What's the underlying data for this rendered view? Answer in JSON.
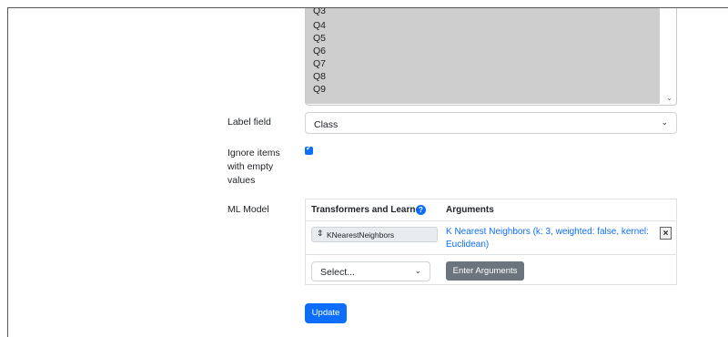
{
  "features": {
    "options": [
      "Q3",
      "Q4",
      "Q5",
      "Q6",
      "Q7",
      "Q8",
      "Q9"
    ]
  },
  "label_field": {
    "label": "Label field",
    "value": "Class"
  },
  "ignore_empty": {
    "label_line1": "Ignore items",
    "label_line2": "with empty",
    "label_line3": "values",
    "checked": true
  },
  "ml_model": {
    "label": "ML Model",
    "col_transformers": "Transformers and Learner",
    "col_arguments": "Arguments",
    "learner_name": "KNearestNeighbors",
    "learner_arguments": "K Nearest Neighbors (k: 3, weighted: false, kernel: Euclidean)",
    "remove_glyph": "×",
    "add_select_value": "Select...",
    "enter_arguments_label": "Enter Arguments"
  },
  "update_label": "Update",
  "colors": {
    "primary": "#0d6efd",
    "secondary": "#6c757d",
    "listbox_selected": "#cecece"
  }
}
